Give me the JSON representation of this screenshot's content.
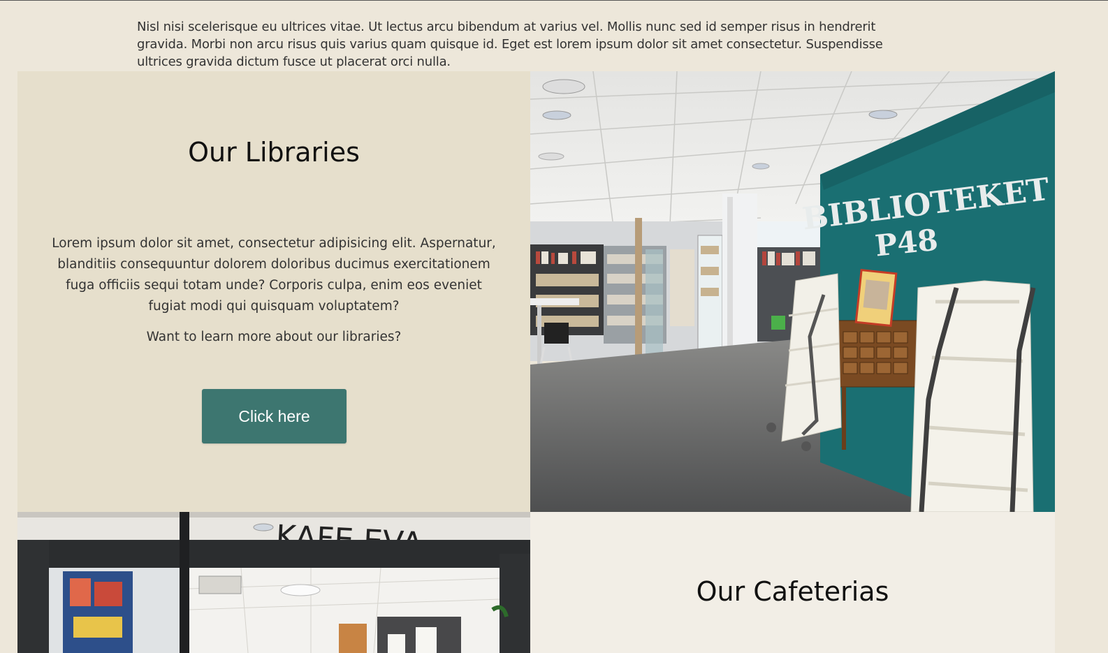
{
  "intro": {
    "text": "Nisl nisi scelerisque eu ultrices vitae. Ut lectus arcu bibendum at varius vel. Mollis nunc sed id semper risus in hendrerit gravida. Morbi non arcu risus quis varius quam quisque id. Eget est lorem ipsum dolor sit amet consectetur. Suspendisse ultrices gravida dictum fusce ut placerat orci nulla."
  },
  "libraries": {
    "title": "Our Libraries",
    "body": "Lorem ipsum dolor sit amet, consectetur adipisicing elit. Aspernatur, blanditiis consequuntur dolorem doloribus ducimus exercitationem fuga officiis sequi totam unde? Corporis culpa, enim eos eveniet fugiat modi qui quisquam voluptatem?",
    "question": "Want to learn more about our libraries?",
    "button_label": "Click here",
    "photo": {
      "sign_line1": "BIBLIOTEKET",
      "sign_line2": "P48"
    }
  },
  "cafeterias": {
    "title": "Our Cafeterias",
    "photo": {
      "sign": "KAFE EVA"
    }
  },
  "colors": {
    "page_bg": "#ede7da",
    "libraries_bg": "#e6dfcc",
    "cafeterias_bg": "#f2eee6",
    "button_bg": "#3d7670",
    "teal_wall": "#1a6f72"
  }
}
